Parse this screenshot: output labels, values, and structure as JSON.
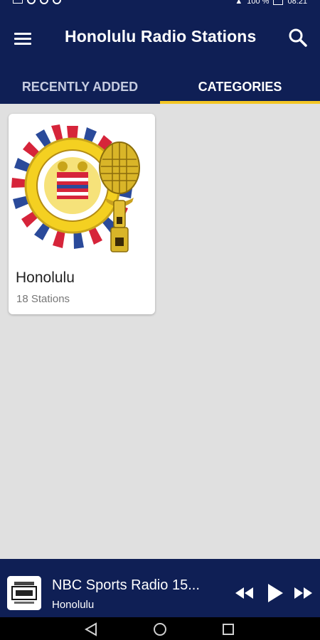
{
  "app": {
    "title": "Honolulu Radio Stations"
  },
  "tabs": [
    {
      "label": "RECENTLY ADDED",
      "active": false
    },
    {
      "label": "CATEGORIES",
      "active": true
    }
  ],
  "categories": [
    {
      "title": "Honolulu",
      "subtitle": "18 Stations",
      "icon": "honolulu-seal-microphone-icon"
    }
  ],
  "player": {
    "title": "NBC Sports Radio 15...",
    "subtitle": "Honolulu",
    "logo_icon": "nbc-sports-radio-logo-icon"
  },
  "status_bar": {
    "battery": "100 %",
    "time": "08:21"
  },
  "colors": {
    "primary": "#0f1f55",
    "accent": "#f3c625",
    "background": "#e0e0e0"
  }
}
